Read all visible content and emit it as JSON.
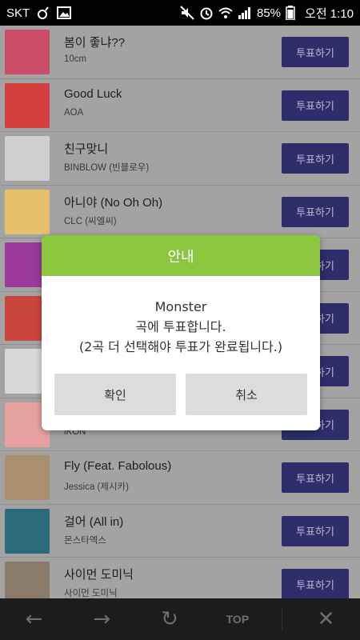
{
  "status_bar": {
    "carrier": "SKT",
    "battery": "85%",
    "time": "오전 1:10"
  },
  "songs": [
    {
      "title": "봄이 좋냐??",
      "artist": "10cm",
      "vote_label": "투표하기",
      "thumb_color": "#c94d66"
    },
    {
      "title": "Good Luck",
      "artist": "AOA",
      "vote_label": "투표하기",
      "thumb_color": "#d44040"
    },
    {
      "title": "친구맞니",
      "artist": "BINBLOW (빈블로우)",
      "vote_label": "투표하기",
      "thumb_color": "#cfcfcf"
    },
    {
      "title": "아니야 (No Oh Oh)",
      "artist": "CLC (씨엘씨)",
      "vote_label": "투표하기",
      "thumb_color": "#e6c06a"
    },
    {
      "title": "",
      "artist": "",
      "vote_label": "투표하기",
      "thumb_color": "#9b3a9a"
    },
    {
      "title": "",
      "artist": "",
      "vote_label": "투표하기",
      "thumb_color": "#c9463d"
    },
    {
      "title": "",
      "artist": "",
      "vote_label": "투표하기",
      "thumb_color": "#d8d8d8"
    },
    {
      "title": "",
      "artist": "iKON",
      "vote_label": "투표하기",
      "thumb_color": "#e7a0a0"
    },
    {
      "title": "Fly (Feat. Fabolous)",
      "artist": "Jessica (제시카)",
      "vote_label": "투표하기",
      "thumb_color": "#a98f6d"
    },
    {
      "title": "걸어 (All in)",
      "artist": "몬스타엑스",
      "vote_label": "투표하기",
      "thumb_color": "#2e6b7a"
    },
    {
      "title": "사이먼 도미닉",
      "artist": "사이먼 도미닉",
      "vote_label": "투표하기",
      "thumb_color": "#8a7a6a"
    }
  ],
  "dialog": {
    "title": "안내",
    "line1": "Monster",
    "line2": "곡에 투표합니다.",
    "line3": "(2곡 더 선택해야 투표가 완료됩니다.)",
    "confirm_label": "확인",
    "cancel_label": "취소",
    "header_color": "#8cc63f"
  },
  "toolbar": {
    "back_icon": "←",
    "forward_icon": "→",
    "refresh_icon": "↻",
    "top_label": "TOP",
    "close_icon": "✕"
  }
}
